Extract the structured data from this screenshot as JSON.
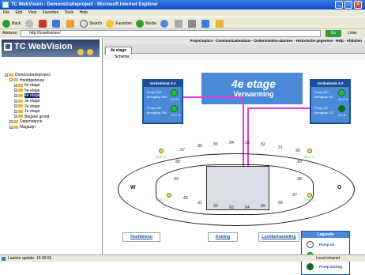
{
  "window": {
    "title": "TC WebVision - Demonstratieproject - Microsoft Internet Explorer"
  },
  "menu": [
    "File",
    "Edit",
    "View",
    "Favorites",
    "Tools",
    "Help"
  ],
  "toolbar": {
    "back": "Back",
    "search": "Search",
    "favorites": "Favorites",
    "media": "Media"
  },
  "address": {
    "label": "Address",
    "value": "http://tcwebvision/",
    "go": "Go",
    "links": "Links"
  },
  "sidebar": {
    "logo": "TC WebVision",
    "tree": [
      {
        "label": "Demonstratieproject",
        "level": 0,
        "selected": false
      },
      {
        "label": "Hoofdgebouw",
        "level": 1,
        "selected": false
      },
      {
        "label": "6e etage",
        "level": 2,
        "selected": false
      },
      {
        "label": "5e etage",
        "level": 2,
        "selected": false
      },
      {
        "label": "4e etage",
        "level": 2,
        "selected": true
      },
      {
        "label": "3e etage",
        "level": 2,
        "selected": false
      },
      {
        "label": "2e etage",
        "level": 2,
        "selected": false
      },
      {
        "label": "1e etage",
        "level": 2,
        "selected": false
      },
      {
        "label": "Begane grond",
        "level": 2,
        "selected": false
      },
      {
        "label": "Dependance",
        "level": 1,
        "selected": false
      },
      {
        "label": "Magazijn",
        "level": 1,
        "selected": false
      }
    ]
  },
  "topnav": "Projectoptics - Communicatiestatus - Ondersteation-alarmen - Historische gegevens - Help - Afsluiten",
  "tab": {
    "label": "4e etage"
  },
  "schema_label": "Schema",
  "heading": {
    "title": "4e etage",
    "subtitle": "Verwarming"
  },
  "panels": [
    {
      "title": "Verdeelstuk 4-1",
      "pump1": "Pump NW",
      "meng1": "Mengklep NW",
      "val1": "0,0 %",
      "pump2": "Pump ZW",
      "meng2": "Mengklep ZW",
      "val2": "13,2 %"
    },
    {
      "title": "Verdeelstuk 4-2",
      "pump1": "Pomp NO",
      "meng1": "Mengklep NO",
      "val1": "10,4 %",
      "pump2": "Pomp ZO",
      "meng2": "Mengklep ZO",
      "val2": "0,0 %"
    }
  ],
  "rooms": [
    ".57",
    ".56",
    ".55",
    ".54",
    ".53",
    ".52",
    ".51",
    ".50",
    ".58",
    ".59",
    ".60",
    ".61",
    ".62",
    ".63",
    ".64",
    ".65",
    ".66",
    ".67",
    ".68",
    ".69"
  ],
  "compass": {
    "w": "W",
    "o": "O"
  },
  "legend": {
    "title": "Legenda",
    "items": [
      "Pomp uit",
      "Pomp aan",
      "Pomp storing"
    ]
  },
  "buttons": {
    "menu": "Hoofdmenu",
    "koeling": "Koeling",
    "lucht": "Luchtbehandeling"
  },
  "status": {
    "left": "Laatste update: 15:33:55",
    "right": "Local intranet"
  },
  "colors": {
    "accent": "#4a8ad8",
    "dark": "#1b4f97",
    "pipe": "#e23adf",
    "pump_on": "#19c332"
  }
}
